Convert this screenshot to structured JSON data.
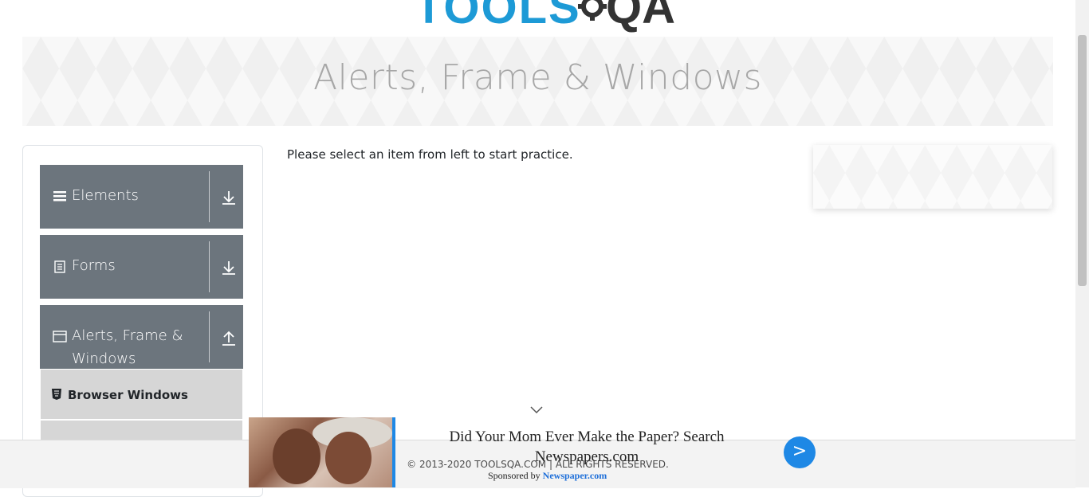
{
  "header": {
    "logo_text_left": "TOOLS",
    "logo_text_right": "QA"
  },
  "banner": {
    "title": "Alerts, Frame & Windows"
  },
  "sidebar": {
    "groups": [
      {
        "label": "Elements",
        "icon": "menu-icon",
        "state": "collapsed"
      },
      {
        "label": "Forms",
        "icon": "document-icon",
        "state": "collapsed"
      },
      {
        "label": "Alerts, Frame & Windows",
        "icon": "window-icon",
        "state": "expanded"
      }
    ],
    "items": [
      {
        "label": "Browser Windows",
        "icon": "html5-icon"
      }
    ]
  },
  "main": {
    "message": "Please select an item from left to start practice."
  },
  "footer": {
    "copyright": "© 2013-2020 TOOLSQA.COM | ALL RIGHTS RESERVED."
  },
  "ad": {
    "headline": "Did Your Mom Ever Make the Paper? Search Newspapers.com",
    "sponsor_prefix": "Sponsored by",
    "sponsor_name": "Newspaper.com",
    "go_label": ">"
  },
  "colors": {
    "accent": "#1e88e5",
    "group_bg": "#6c757d",
    "sub_item_bg": "#d6d6d6",
    "banner_text": "#a7a7a7"
  }
}
